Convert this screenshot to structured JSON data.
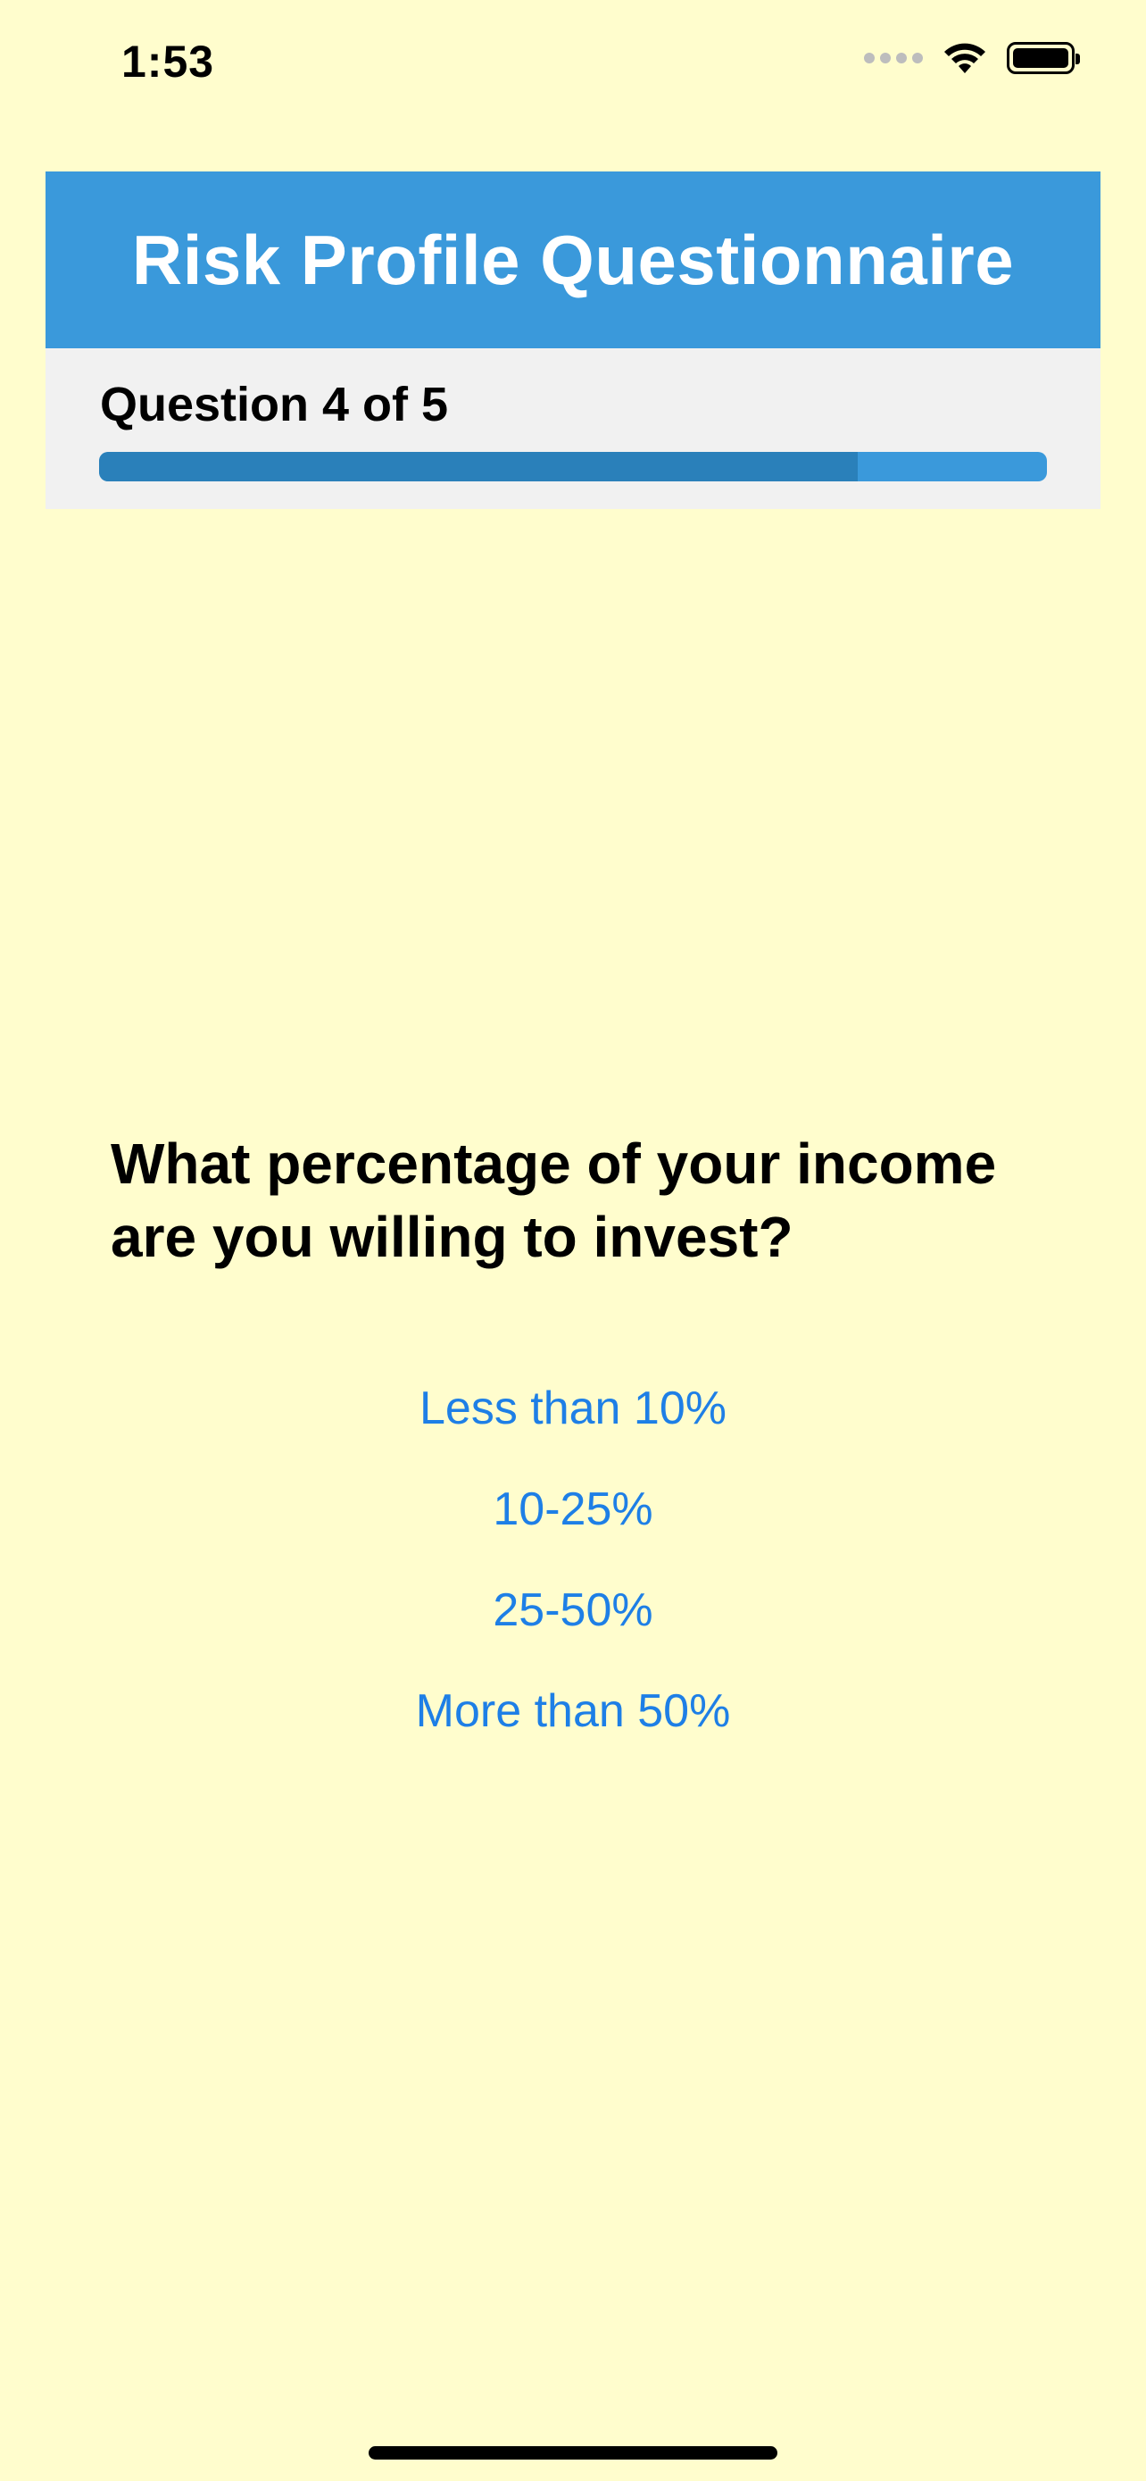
{
  "status_bar": {
    "time": "1:53",
    "icons": [
      "cellular-signal-icon",
      "wifi-icon",
      "battery-icon"
    ]
  },
  "header": {
    "title": "Risk Profile Questionnaire",
    "background_color": "#3A99DB"
  },
  "progress": {
    "label": "Question 4 of 5",
    "fraction": 0.8,
    "fill_color": "#2A80BA",
    "track_color": "#3A99DB"
  },
  "question": {
    "text": "What percentage of your income are you willing to invest?"
  },
  "options": [
    {
      "label": "Less than 10%"
    },
    {
      "label": "10-25%"
    },
    {
      "label": "25-50%"
    },
    {
      "label": "More than 50%"
    }
  ],
  "colors": {
    "background": "#FFFDCD",
    "option_text": "#1E7FE6"
  }
}
